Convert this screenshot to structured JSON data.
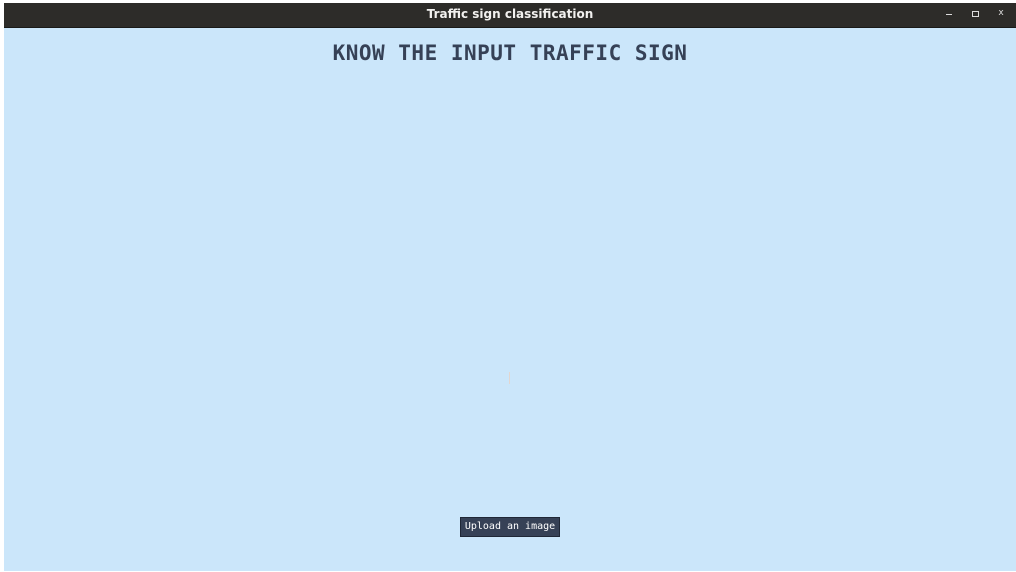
{
  "window": {
    "title": "Traffic sign classification",
    "controls": {
      "close_glyph": "x"
    }
  },
  "main": {
    "heading": "KNOW THE INPUT TRAFFIC SIGN",
    "upload_label": "Upload an image"
  },
  "colors": {
    "titlebar": "#2d2c29",
    "background": "#cbe6fa",
    "heading": "#364156",
    "button": "#364156",
    "button_text": "#ffffff"
  }
}
